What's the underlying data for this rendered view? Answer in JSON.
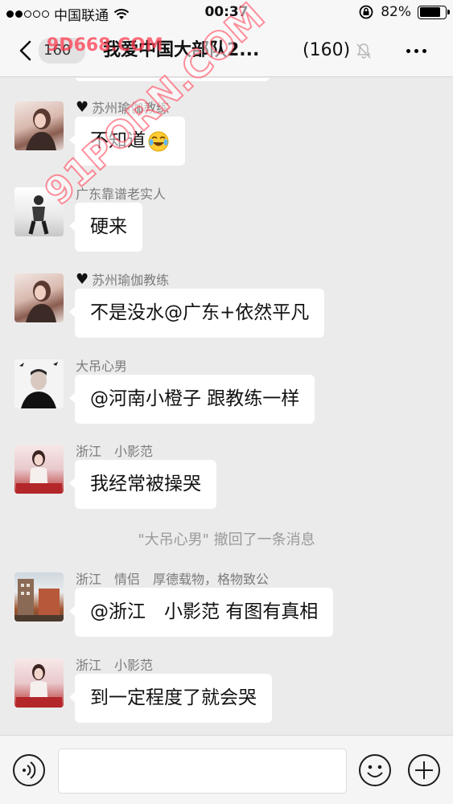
{
  "status_bar": {
    "carrier": "中国联通",
    "time": "00:37",
    "battery": "82%",
    "battery_level": 0.82,
    "signal_bars": 2
  },
  "nav": {
    "back_count": "160",
    "title": "我爱中国大部队2...",
    "member_count": "(160)"
  },
  "messages": [
    {
      "sender": "苏州瑜伽教练",
      "heart": true,
      "text": "不知道",
      "emoji": "tear-laugh-emoji"
    },
    {
      "sender": "广东靠谱老实人",
      "heart": false,
      "text": "硬来"
    },
    {
      "sender": "苏州瑜伽教练",
      "heart": true,
      "text": "不是没水@广东+依然平凡"
    },
    {
      "sender": "大吊心男",
      "heart": false,
      "text": "@河南小橙子 跟教练一样"
    },
    {
      "sender": "浙江　小影范",
      "heart": false,
      "text": "我经常被操哭"
    },
    {
      "sender": "浙江　情侣　厚德载物，格物致公",
      "heart": false,
      "text": "@浙江　小影范 有图有真相"
    },
    {
      "sender": "浙江　小影范",
      "heart": false,
      "text": "到一定程度了就会哭"
    }
  ],
  "system_note": "\"大吊心男\" 撤回了一条消息",
  "watermarks": {
    "top": "9D668.COM",
    "diagonal": "91PORN.COM"
  },
  "colors": {
    "background": "#ebebeb",
    "bubble": "#ffffff",
    "sender_text": "#7b7b7b",
    "watermark": "#ff3b4f"
  }
}
